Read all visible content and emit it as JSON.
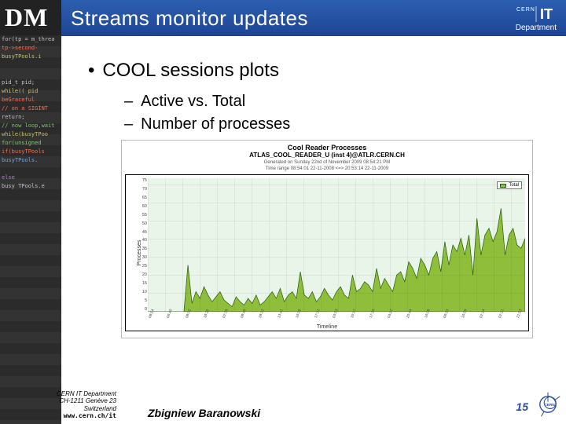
{
  "title": "Streams monitor updates",
  "logo_top": "CERN IT",
  "logo_bottom": "Department",
  "bul1": "COOL sessions plots",
  "bul2a": "Active vs. Total",
  "bul2b": "Number of processes",
  "dept_l1": "CERN IT Department",
  "dept_l2": "CH-1211 Genève 23",
  "dept_l3": "Switzerland",
  "dept_url": "www.cern.ch/it",
  "author": "Zbigniew Baranowski",
  "page": "15",
  "chart_data": {
    "type": "area",
    "title": "Cool Reader Processes",
    "subtitle": "ATLAS_COOL_READER_U (inst 4)@ATLR.CERN.CH",
    "meta_l1": "Generated on Sunday 22nd of November 2009 08:54:21 PM",
    "meta_l2": "Time range 08:54:01 22-11-2008 <=> 20:53:14 22-11-2009",
    "xlabel": "Timeline",
    "ylabel": "Processes",
    "legend": "Total",
    "ylim": [
      0,
      80
    ],
    "yticks": [
      "75",
      "70",
      "65",
      "60",
      "55",
      "50",
      "45",
      "40",
      "35",
      "30",
      "25",
      "20",
      "15",
      "10",
      "5",
      "0"
    ],
    "xticks": [
      "08:54",
      "06:40",
      "08:02",
      "18:25",
      "02:36",
      "08:49",
      "19:32",
      "13:41",
      "16:06",
      "17:31",
      "03:53",
      "15:17",
      "17:30",
      "04:07",
      "20:44",
      "16:08",
      "06:23",
      "16:09",
      "02:14",
      "02:21",
      "21:53"
    ],
    "values": [
      0,
      0,
      0,
      0,
      0,
      0,
      0,
      0,
      0,
      0,
      28,
      5,
      12,
      8,
      15,
      10,
      6,
      9,
      12,
      7,
      5,
      3,
      9,
      6,
      4,
      8,
      5,
      10,
      4,
      6,
      9,
      12,
      8,
      14,
      6,
      10,
      12,
      8,
      24,
      10,
      8,
      12,
      6,
      9,
      14,
      10,
      7,
      12,
      15,
      10,
      8,
      22,
      12,
      14,
      18,
      16,
      12,
      26,
      14,
      20,
      16,
      12,
      22,
      24,
      18,
      30,
      26,
      20,
      32,
      28,
      22,
      32,
      36,
      24,
      42,
      28,
      40,
      36,
      44,
      34,
      46,
      22,
      56,
      34,
      46,
      50,
      42,
      48,
      62,
      34,
      46,
      50,
      40,
      38,
      44
    ]
  }
}
